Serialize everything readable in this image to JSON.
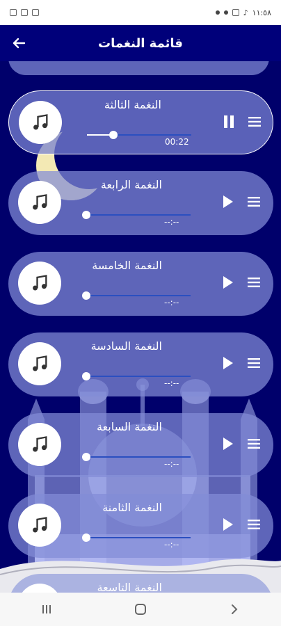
{
  "status_bar": {
    "time": "١١:٥٨"
  },
  "header": {
    "title": "قائمة النغمات"
  },
  "tones": [
    {
      "name": "النغمة الثالثة",
      "time": "00:22",
      "state": "playing",
      "progress": 0.25
    },
    {
      "name": "النغمة الرابعة",
      "time": "--:--",
      "state": "stopped",
      "progress": 0
    },
    {
      "name": "النغمة الخامسة",
      "time": "--:--",
      "state": "stopped",
      "progress": 0
    },
    {
      "name": "النغمة السادسة",
      "time": "--:--",
      "state": "stopped",
      "progress": 0
    },
    {
      "name": "النغمة السابعة",
      "time": "--:--",
      "state": "stopped",
      "progress": 0
    },
    {
      "name": "النغمة الثامنة",
      "time": "--:--",
      "state": "stopped",
      "progress": 0
    },
    {
      "name": "النغمة التاسعة",
      "time": "",
      "state": "stopped",
      "progress": 0
    }
  ],
  "icons": {
    "back": "arrow-left-icon",
    "tone": "music-note-icon",
    "play": "play-icon",
    "pause": "pause-icon",
    "menu": "drag-handle-icon",
    "nav_recent": "recent-apps-icon",
    "nav_home": "home-icon",
    "nav_back": "chevron-right-icon"
  },
  "colors": {
    "background": "#00006b",
    "app_bar": "#00007a",
    "card": "#828cd7",
    "track": "#2b4fc0",
    "moon": "#f3e9b4"
  }
}
